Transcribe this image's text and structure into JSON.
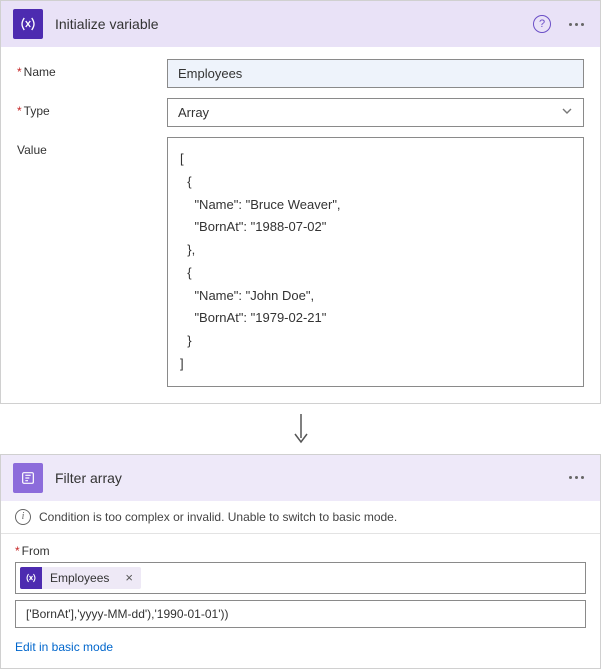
{
  "init_var": {
    "title": "Initialize variable",
    "name_label": "Name",
    "name_value": "Employees",
    "type_label": "Type",
    "type_value": "Array",
    "value_label": "Value",
    "value_text": "[\n  {\n    \"Name\": \"Bruce Weaver\",\n    \"BornAt\": \"1988-07-02\"\n  },\n  {\n    \"Name\": \"John Doe\",\n    \"BornAt\": \"1979-02-21\"\n  }\n]"
  },
  "filter": {
    "title": "Filter array",
    "info_text": "Condition is too complex or invalid. Unable to switch to basic mode.",
    "from_label": "From",
    "token_label": "Employees",
    "expression": "['BornAt'],'yyyy-MM-dd'),'1990-01-01'))",
    "edit_link": "Edit in basic mode"
  }
}
